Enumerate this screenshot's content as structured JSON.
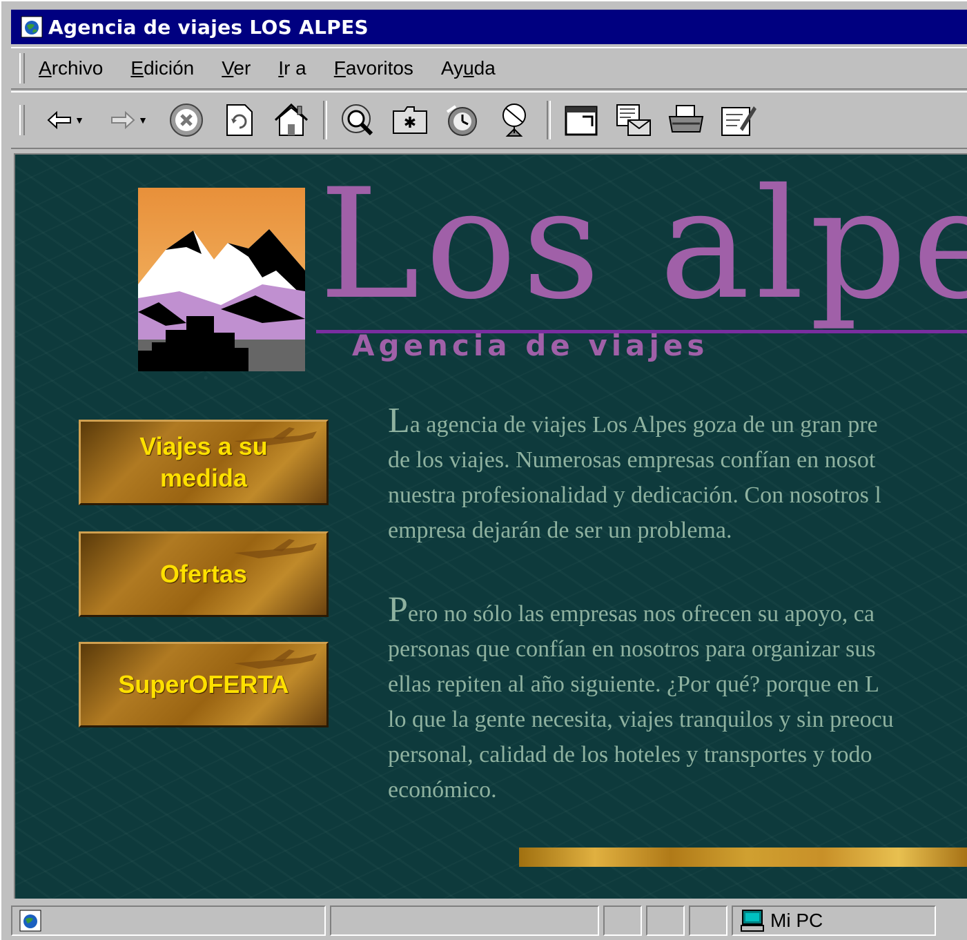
{
  "window": {
    "title": "Agencia de viajes LOS ALPES",
    "icon": "ie-page-icon"
  },
  "menu": [
    {
      "label_pre": "",
      "acc": "A",
      "label_post": "rchivo"
    },
    {
      "label_pre": "",
      "acc": "E",
      "label_post": "dición"
    },
    {
      "label_pre": "",
      "acc": "V",
      "label_post": "er"
    },
    {
      "label_pre": "",
      "acc": "I",
      "label_post": "r a"
    },
    {
      "label_pre": "",
      "acc": "F",
      "label_post": "avoritos"
    },
    {
      "label_pre": "Ay",
      "acc": "u",
      "label_post": "da"
    }
  ],
  "toolbar": {
    "icons": [
      "back-icon",
      "forward-icon",
      "stop-icon",
      "refresh-icon",
      "home-icon",
      "search-icon",
      "favorites-icon",
      "history-icon",
      "channels-icon",
      "fullscreen-icon",
      "mail-icon",
      "print-icon",
      "edit-icon"
    ]
  },
  "page": {
    "brand": "Los alpes",
    "tagline": "Agencia de viajes",
    "nav": [
      {
        "line1": "Viajes a su",
        "line2": "medida"
      },
      {
        "line1": "Ofertas",
        "line2": ""
      },
      {
        "line1": "SuperOFERTA",
        "line2": ""
      }
    ],
    "para1": {
      "cap": "L",
      "lines": [
        "a agencia de viajes Los Alpes goza de un gran pre",
        "de los viajes. Numerosas empresas confían en nosot",
        "nuestra profesionalidad y dedicación. Con nosotros l",
        "empresa dejarán de ser un problema."
      ]
    },
    "para2": {
      "cap": "P",
      "lines": [
        "ero no sólo las empresas nos ofrecen su apoyo, ca",
        "personas que confían en nosotros para organizar sus",
        "ellas repiten al año siguiente. ¿Por qué? porque en L",
        "lo que la gente necesita, viajes tranquilos y sin preocu",
        "personal, calidad de los hoteles y transportes y todo",
        "económico."
      ]
    }
  },
  "status": {
    "zone": "Mi PC"
  },
  "colors": {
    "titlebar": "#000080",
    "content_bg": "#0e3a3c",
    "brand": "#a060a8",
    "nav_text": "#ffe000",
    "body_text": "#8fb2a0"
  }
}
